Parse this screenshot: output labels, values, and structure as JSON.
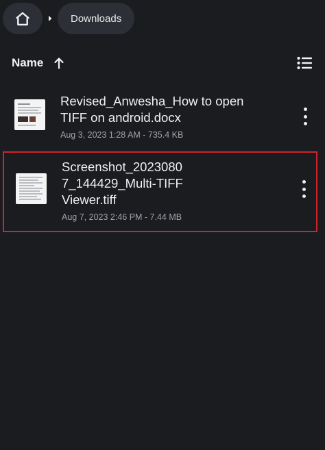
{
  "breadcrumb": {
    "home_icon": "home-icon",
    "separator_icon": "chevron-right-icon",
    "current_folder": "Downloads"
  },
  "sort": {
    "label": "Name",
    "direction_icon": "arrow-up-icon",
    "view_toggle_icon": "list-view-icon"
  },
  "files": [
    {
      "name": "Revised_Anwesha_How to open\nTIFF on android.docx",
      "meta": "Aug 3, 2023 1:28 AM - 735.4 KB",
      "selected": false,
      "menu_icon": "more-vert-icon"
    },
    {
      "name": "Screenshot_2023080\n7_144429_Multi-TIFF\nViewer.tiff",
      "meta": "Aug 7, 2023 2:46 PM - 7.44 MB",
      "selected": true,
      "menu_icon": "more-vert-icon"
    }
  ],
  "colors": {
    "background": "#1a1c20",
    "chip": "#2c2f35",
    "text_primary": "#eef0f2",
    "text_secondary": "#9ea2a8",
    "highlight_border": "#d2232a"
  }
}
